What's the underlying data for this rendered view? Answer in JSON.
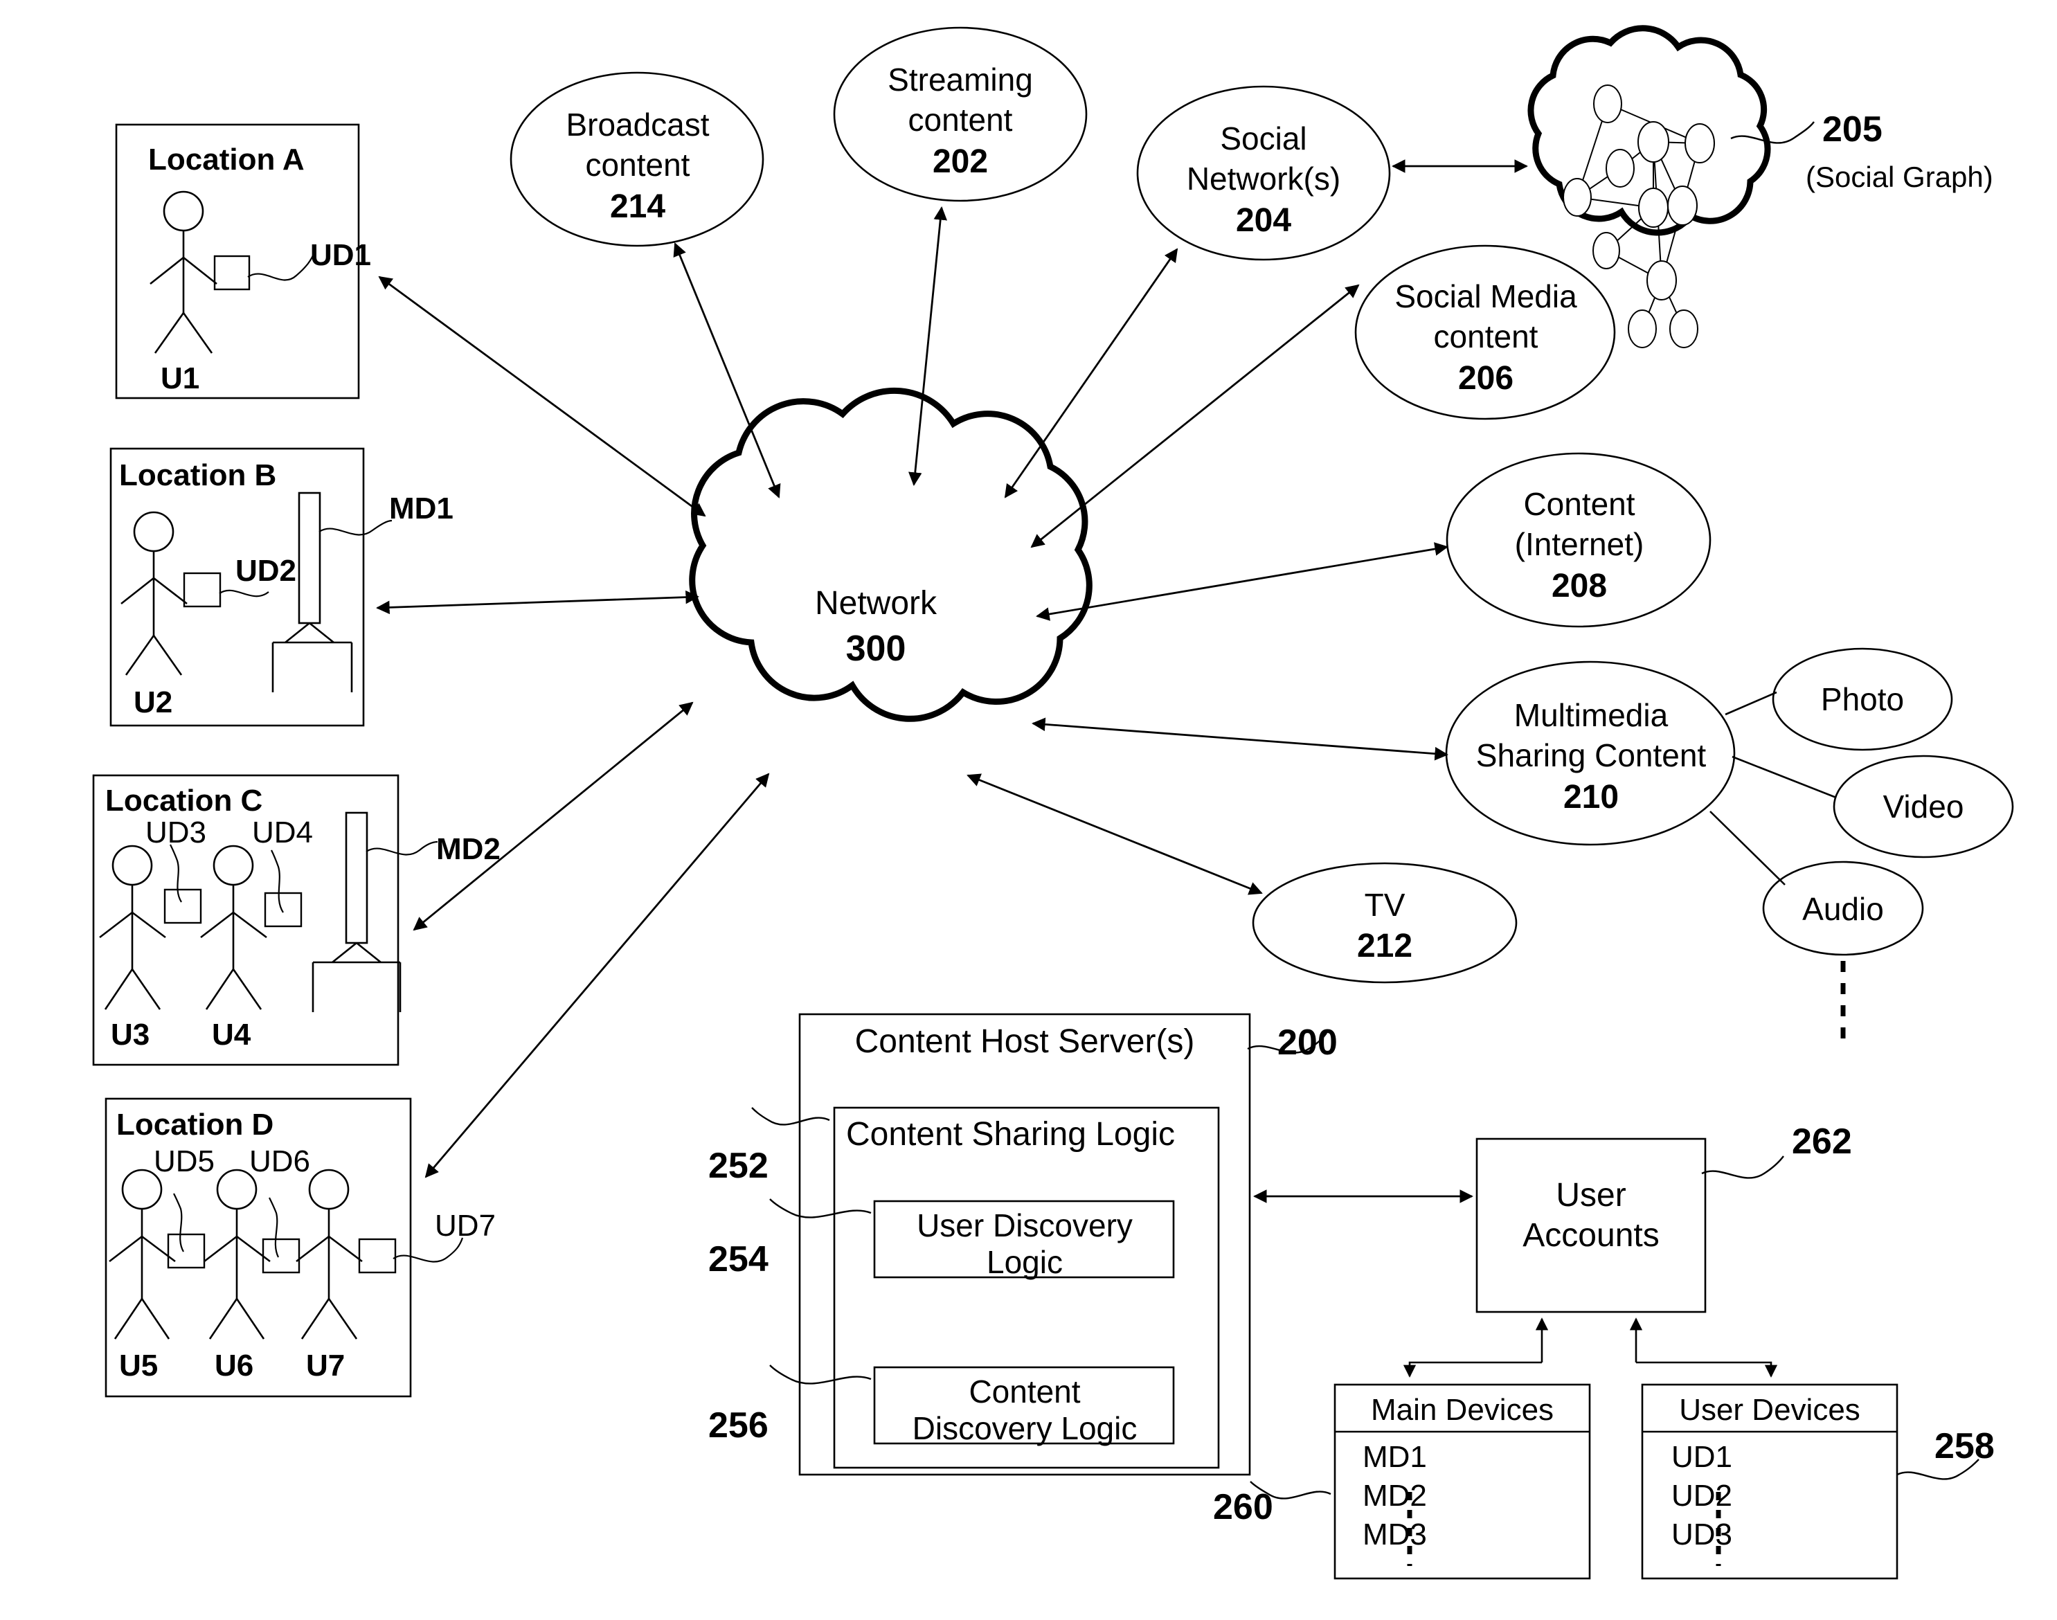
{
  "figure": {
    "type": "patent-network-diagram",
    "network": {
      "label": "Network",
      "ref": "300"
    },
    "social_graph_cloud": {
      "ref": "205",
      "caption": "(Social Graph)"
    },
    "content_nodes": [
      {
        "id": "broadcast",
        "line1": "Broadcast",
        "line2": "content",
        "ref": "214"
      },
      {
        "id": "streaming",
        "line1": "Streaming",
        "line2": "content",
        "ref": "202"
      },
      {
        "id": "social_networks",
        "line1": "Social",
        "line2": "Network(s)",
        "ref": "204"
      },
      {
        "id": "social_media",
        "line1": "Social Media",
        "line2": "content",
        "ref": "206"
      },
      {
        "id": "internet_content",
        "line1": "Content",
        "line2": "(Internet)",
        "ref": "208"
      },
      {
        "id": "multimedia",
        "line1": "Multimedia",
        "line2": "Sharing Content",
        "ref": "210"
      },
      {
        "id": "tv",
        "line1": "TV",
        "line2": "",
        "ref": "212"
      }
    ],
    "media_types": [
      {
        "id": "photo",
        "label": "Photo"
      },
      {
        "id": "video",
        "label": "Video"
      },
      {
        "id": "audio",
        "label": "Audio"
      }
    ],
    "locations": [
      {
        "id": "a",
        "title": "Location A",
        "users": [
          {
            "user": "U1",
            "device": "UD1"
          }
        ],
        "main_device": null
      },
      {
        "id": "b",
        "title": "Location B",
        "users": [
          {
            "user": "U2",
            "device": "UD2"
          }
        ],
        "main_device": "MD1"
      },
      {
        "id": "c",
        "title": "Location C",
        "users": [
          {
            "user": "U3",
            "device": "UD3"
          },
          {
            "user": "U4",
            "device": "UD4"
          }
        ],
        "main_device": "MD2"
      },
      {
        "id": "d",
        "title": "Location D",
        "users": [
          {
            "user": "U5",
            "device": "UD5"
          },
          {
            "user": "U6",
            "device": "UD6"
          },
          {
            "user": "U7",
            "device": "UD7"
          }
        ],
        "main_device": null
      }
    ],
    "server": {
      "title": "Content Host Server(s)",
      "ref": "200",
      "sharing_logic": {
        "title": "Content Sharing Logic",
        "ref": "252"
      },
      "modules": [
        {
          "line1": "User Discovery",
          "line2": "Logic",
          "ref": "254"
        },
        {
          "line1": "Content",
          "line2": "Discovery Logic",
          "ref": "256"
        }
      ]
    },
    "user_accounts": {
      "line1": "User",
      "line2": "Accounts",
      "ref": "262"
    },
    "device_tables": [
      {
        "id": "main",
        "header": "Main Devices",
        "rows": [
          "MD1",
          "MD2",
          "MD3"
        ],
        "ellipsis": "⋮",
        "ref": "260"
      },
      {
        "id": "user",
        "header": "User Devices",
        "rows": [
          "UD1",
          "UD2",
          "UD3"
        ],
        "ellipsis": "⋮",
        "ref": "258"
      }
    ],
    "colors": {
      "ink": "#000000",
      "paper": "#ffffff"
    }
  }
}
